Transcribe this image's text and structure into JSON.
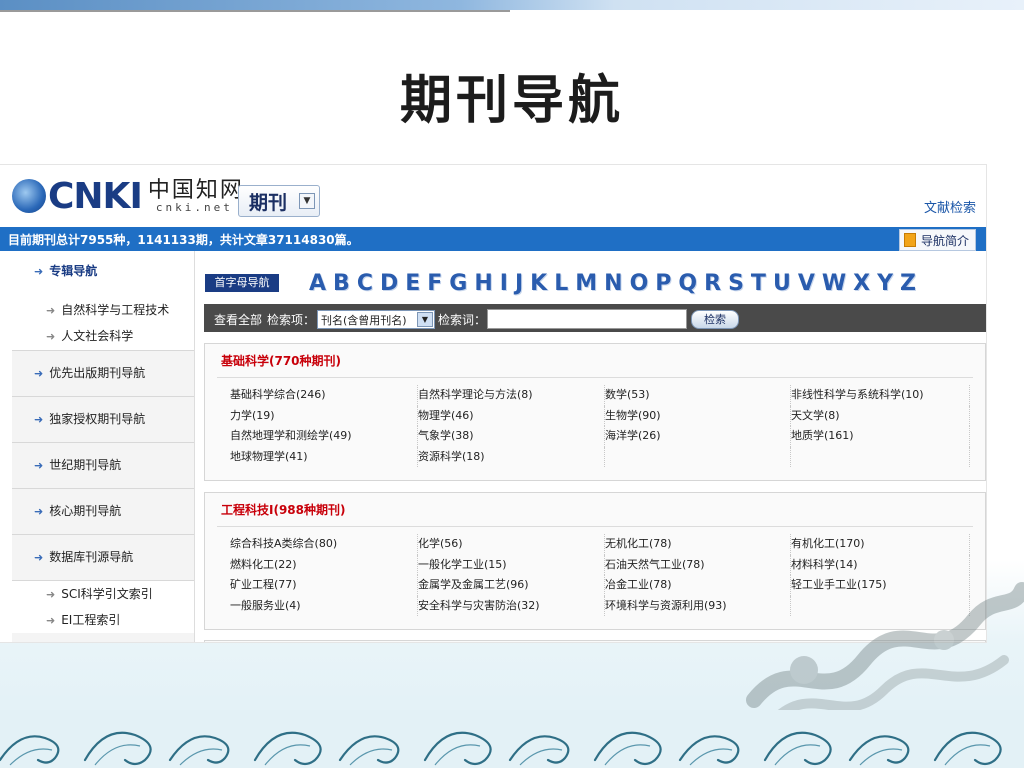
{
  "slide": {
    "title": "期刊导航"
  },
  "header": {
    "logo_mark": "CNKI",
    "logo_cn": "中国知网",
    "logo_en": "cnki.net",
    "product_label": "期刊",
    "doc_search_link": "文献检索"
  },
  "statbar": {
    "text": "目前期刊总计7955种，1141133期，共计文章37114830篇。",
    "nav_intro_label": "导航简介"
  },
  "sidebar": {
    "items": [
      {
        "label": "专辑导航",
        "active": true
      },
      {
        "label": "自然科学与工程技术",
        "sub": true
      },
      {
        "label": "人文社会科学",
        "sub": true
      },
      {
        "label": "优先出版期刊导航"
      },
      {
        "label": "独家授权期刊导航"
      },
      {
        "label": "世纪期刊导航"
      },
      {
        "label": "核心期刊导航"
      },
      {
        "label": "数据库刊源导航"
      },
      {
        "label": "SCI科学引文索引",
        "sub": true
      },
      {
        "label": "EI工程索引",
        "sub": true
      }
    ]
  },
  "alpha_nav": {
    "tag": "首字母导航",
    "letters": [
      "A",
      "B",
      "C",
      "D",
      "E",
      "F",
      "G",
      "H",
      "I",
      "J",
      "K",
      "L",
      "M",
      "N",
      "O",
      "P",
      "Q",
      "R",
      "S",
      "T",
      "U",
      "V",
      "W",
      "X",
      "Y",
      "Z"
    ]
  },
  "search": {
    "view_all": "查看全部",
    "field_label": "检索项：",
    "field_value": "刊名(含曾用刊名)",
    "keyword_label": "检索词：",
    "keyword_value": "",
    "button": "检索"
  },
  "categories": [
    {
      "title": "基础科学(770种期刊)",
      "items": [
        "基础科学综合(246)",
        "自然科学理论与方法(8)",
        "数学(53)",
        "非线性科学与系统科学(10)",
        "力学(19)",
        "物理学(46)",
        "生物学(90)",
        "天文学(8)",
        "自然地理学和测绘学(49)",
        "气象学(38)",
        "海洋学(26)",
        "地质学(161)",
        "地球物理学(41)",
        "资源科学(18)",
        "",
        ""
      ]
    },
    {
      "title": "工程科技I(988种期刊)",
      "items": [
        "综合科技A类综合(80)",
        "化学(56)",
        "无机化工(78)",
        "有机化工(170)",
        "燃料化工(22)",
        "一般化学工业(15)",
        "石油天然气工业(78)",
        "材料科学(14)",
        "矿业工程(77)",
        "金属学及金属工艺(96)",
        "冶金工业(78)",
        "轻工业手工业(175)",
        "一般服务业(4)",
        "安全科学与灾害防治(32)",
        "环境科学与资源利用(93)",
        ""
      ]
    }
  ]
}
